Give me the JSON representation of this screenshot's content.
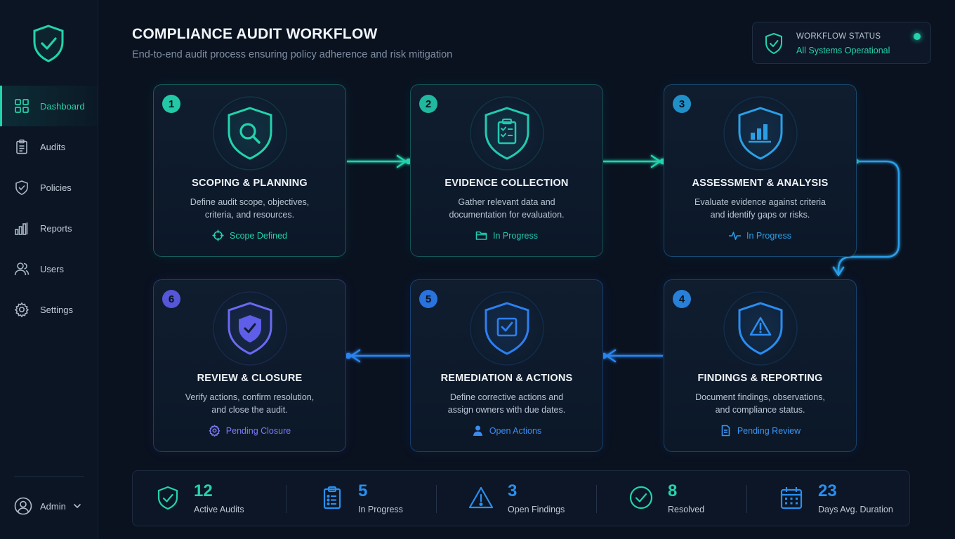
{
  "header": {
    "title": "COMPLIANCE AUDIT WORKFLOW",
    "subtitle": "End-to-end audit process ensuring policy adherence and risk mitigation"
  },
  "status": {
    "title": "WORKFLOW STATUS",
    "value": "All Systems Operational",
    "icon": "shield-check-icon"
  },
  "sidebar": {
    "items": [
      {
        "label": "Dashboard",
        "icon": "grid-icon",
        "active": true
      },
      {
        "label": "Audits",
        "icon": "clipboard-icon"
      },
      {
        "label": "Policies",
        "icon": "shield-icon"
      },
      {
        "label": "Reports",
        "icon": "bar-chart-icon"
      },
      {
        "label": "Users",
        "icon": "users-icon"
      },
      {
        "label": "Settings",
        "icon": "gear-icon"
      }
    ],
    "user": {
      "label": "Admin",
      "icon": "user-circle-icon"
    }
  },
  "steps": [
    {
      "number": "1",
      "title": "SCOPING & PLANNING",
      "desc1": "Define audit scope, objectives,",
      "desc2": "criteria, and resources.",
      "status": "Scope Defined",
      "icon": "magnifier-icon",
      "status_icon": "crosshair-icon",
      "color": "#23d3ac"
    },
    {
      "number": "2",
      "title": "EVIDENCE COLLECTION",
      "desc1": "Gather relevant data and",
      "desc2": "documentation for evaluation.",
      "status": "In Progress",
      "icon": "clipboard-check-icon",
      "status_icon": "folder-icon",
      "color": "#22c9b0"
    },
    {
      "number": "3",
      "title": "ASSESSMENT & ANALYSIS",
      "desc1": "Evaluate evidence against criteria",
      "desc2": "and identify gaps or risks.",
      "status": "In Progress",
      "icon": "bar-chart-icon",
      "status_icon": "pulse-icon",
      "color": "#2a9fe6"
    },
    {
      "number": "4",
      "title": "FINDINGS & REPORTING",
      "desc1": "Document findings, observations,",
      "desc2": "and compliance status.",
      "status": "Pending Review",
      "icon": "warning-icon",
      "status_icon": "document-icon",
      "color": "#2b8cf0"
    },
    {
      "number": "5",
      "title": "REMEDIATION & ACTIONS",
      "desc1": "Define corrective actions and",
      "desc2": "assign owners with due dates.",
      "status": "Open Actions",
      "icon": "checkbox-icon",
      "status_icon": "person-icon",
      "color": "#2d7ff0"
    },
    {
      "number": "6",
      "title": "REVIEW & CLOSURE",
      "desc1": "Verify actions, confirm resolution,",
      "desc2": "and close the audit.",
      "status": "Pending Closure",
      "icon": "shield-check-icon",
      "status_icon": "gear-icon",
      "color": "#6a6af2"
    }
  ],
  "stats": [
    {
      "value": "12",
      "label": "Active Audits",
      "icon": "shield-check-icon",
      "color": "#23d3ac"
    },
    {
      "value": "5",
      "label": "In Progress",
      "icon": "clipboard-list-icon",
      "color": "#2a8ff0"
    },
    {
      "value": "3",
      "label": "Open Findings",
      "icon": "warning-icon",
      "color": "#2a8ff0"
    },
    {
      "value": "8",
      "label": "Resolved",
      "icon": "check-circle-icon",
      "color": "#23d3ac"
    },
    {
      "value": "23",
      "label": "Days Avg. Duration",
      "icon": "calendar-icon",
      "color": "#2a8ff0"
    }
  ]
}
